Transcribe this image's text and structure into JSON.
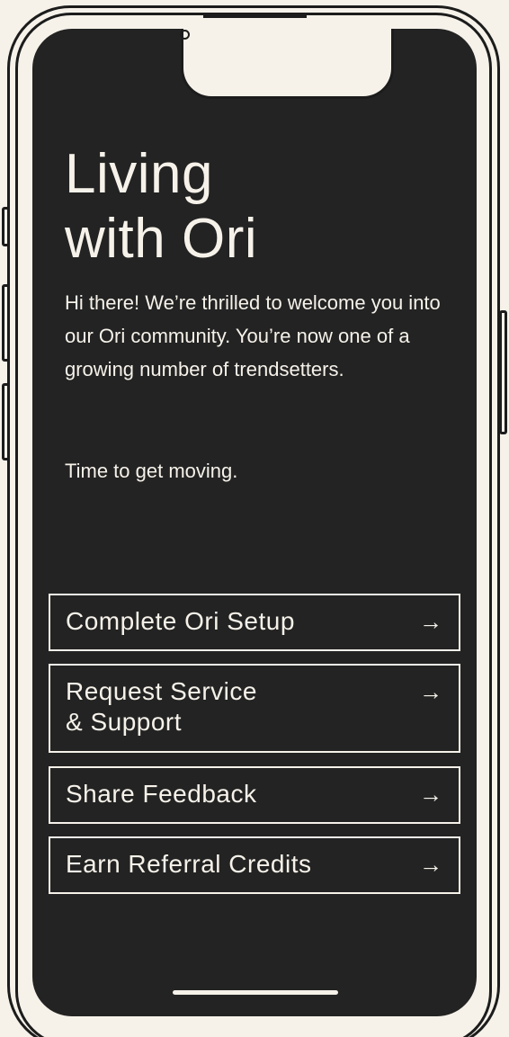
{
  "screen": {
    "title_line1": "Living",
    "title_line2": "with Ori",
    "intro": "Hi there! We’re thrilled to welcome you into our Ori community. You’re now one of a growing number of trendsetters.",
    "tagline": "Time to get moving."
  },
  "actions": [
    {
      "label": "Complete Ori Setup",
      "icon": "arrow-right-icon"
    },
    {
      "label": "Request Service\n& Support",
      "icon": "arrow-right-icon"
    },
    {
      "label": "Share Feedback",
      "icon": "arrow-right-icon"
    },
    {
      "label": "Earn Referral Credits",
      "icon": "arrow-right-icon"
    }
  ],
  "colors": {
    "background": "#f6f2ea",
    "screen": "#232323",
    "text": "#f6f2ea",
    "outline": "#1c1c1c"
  }
}
